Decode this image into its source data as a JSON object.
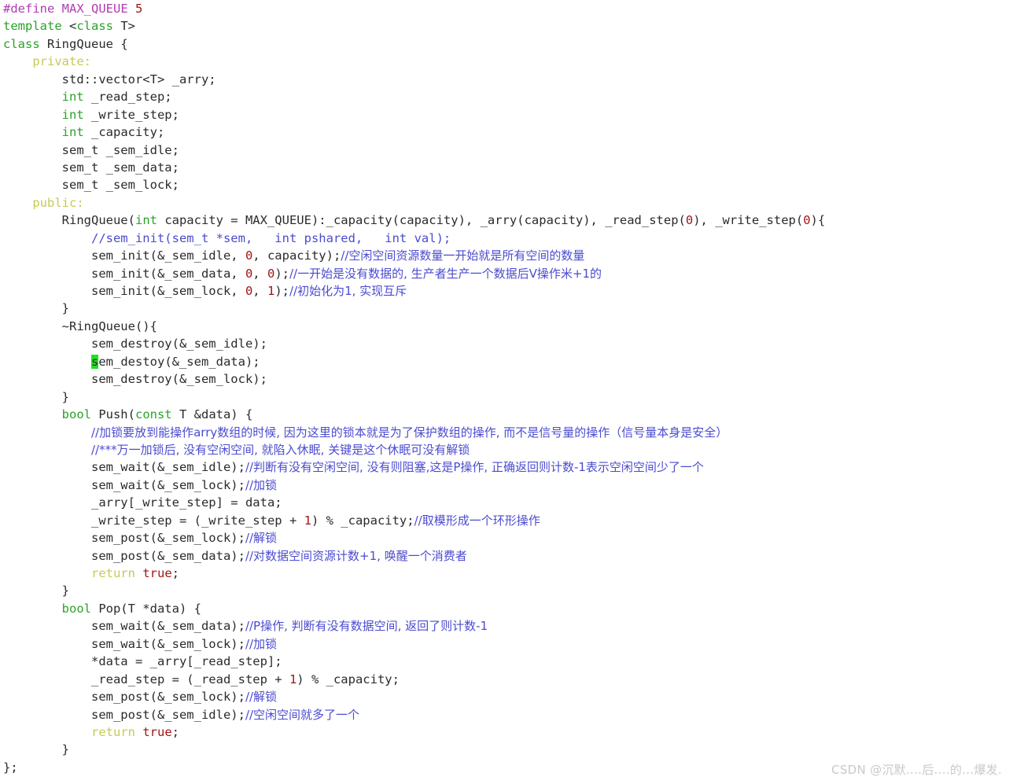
{
  "editor": {
    "language": "cpp",
    "theme_background": "#ffffff",
    "colors": {
      "preprocessor": "#b23bb2",
      "keyword_type": "#29a329",
      "access_specifier": "#c6ca55",
      "number": "#a31515",
      "boolean": "#a31515",
      "return_keyword": "#c6ca55",
      "comment": "#4b4bd0",
      "plain_text": "#2b2b2b",
      "cursor_highlight": "#22e022"
    },
    "cursor": {
      "line": 18,
      "highlighted_char": "s"
    }
  },
  "lines": [
    {
      "id": 1,
      "indent": 0,
      "tokens": [
        {
          "t": "#define",
          "c": "pre"
        },
        {
          "t": " ",
          "c": "plain"
        },
        {
          "t": "MAX_QUEUE",
          "c": "macro"
        },
        {
          "t": " ",
          "c": "plain"
        },
        {
          "t": "5",
          "c": "num"
        }
      ]
    },
    {
      "id": 2,
      "indent": 0,
      "tokens": [
        {
          "t": "template",
          "c": "kw"
        },
        {
          "t": " <",
          "c": "plain"
        },
        {
          "t": "class",
          "c": "kw"
        },
        {
          "t": " T>",
          "c": "plain"
        }
      ]
    },
    {
      "id": 3,
      "indent": 0,
      "tokens": [
        {
          "t": "class",
          "c": "kw"
        },
        {
          "t": " RingQueue {",
          "c": "plain"
        }
      ]
    },
    {
      "id": 4,
      "indent": 1,
      "tokens": [
        {
          "t": "private",
          "c": "access"
        },
        {
          "t": ":",
          "c": "access"
        }
      ]
    },
    {
      "id": 5,
      "indent": 2,
      "tokens": [
        {
          "t": "std::vector<T> _arry;",
          "c": "plain"
        }
      ]
    },
    {
      "id": 6,
      "indent": 2,
      "tokens": [
        {
          "t": "int",
          "c": "kw"
        },
        {
          "t": " _read_step;",
          "c": "plain"
        }
      ]
    },
    {
      "id": 7,
      "indent": 2,
      "tokens": [
        {
          "t": "int",
          "c": "kw"
        },
        {
          "t": " _write_step;",
          "c": "plain"
        }
      ]
    },
    {
      "id": 8,
      "indent": 2,
      "tokens": [
        {
          "t": "int",
          "c": "kw"
        },
        {
          "t": " _capacity;",
          "c": "plain"
        }
      ]
    },
    {
      "id": 9,
      "indent": 2,
      "tokens": [
        {
          "t": "sem_t _sem_idle;",
          "c": "plain"
        }
      ]
    },
    {
      "id": 10,
      "indent": 2,
      "tokens": [
        {
          "t": "sem_t _sem_data;",
          "c": "plain"
        }
      ]
    },
    {
      "id": 11,
      "indent": 2,
      "tokens": [
        {
          "t": "sem_t _sem_lock;",
          "c": "plain"
        }
      ]
    },
    {
      "id": 12,
      "indent": 1,
      "tokens": [
        {
          "t": "public",
          "c": "access"
        },
        {
          "t": ":",
          "c": "access"
        }
      ]
    },
    {
      "id": 13,
      "indent": 2,
      "tokens": [
        {
          "t": "RingQueue(",
          "c": "plain"
        },
        {
          "t": "int",
          "c": "kw"
        },
        {
          "t": " capacity = MAX_QUEUE):_capacity(capacity), _arry(capacity), _read_step(",
          "c": "plain"
        },
        {
          "t": "0",
          "c": "num"
        },
        {
          "t": "), _write_step(",
          "c": "plain"
        },
        {
          "t": "0",
          "c": "num"
        },
        {
          "t": "){",
          "c": "plain"
        }
      ]
    },
    {
      "id": 14,
      "indent": 3,
      "tokens": [
        {
          "t": "//sem_init(sem_t *sem,   int pshared,   int val);",
          "c": "cmt"
        }
      ]
    },
    {
      "id": 15,
      "indent": 3,
      "tokens": [
        {
          "t": "sem_init(&_sem_idle, ",
          "c": "plain"
        },
        {
          "t": "0",
          "c": "num"
        },
        {
          "t": ", capacity);",
          "c": "plain"
        },
        {
          "t": "//空闲空间资源数量一开始就是所有空间的数量",
          "c": "cmt-cn"
        }
      ]
    },
    {
      "id": 16,
      "indent": 3,
      "tokens": [
        {
          "t": "sem_init(&_sem_data, ",
          "c": "plain"
        },
        {
          "t": "0",
          "c": "num"
        },
        {
          "t": ", ",
          "c": "plain"
        },
        {
          "t": "0",
          "c": "num"
        },
        {
          "t": ");",
          "c": "plain"
        },
        {
          "t": "//一开始是没有数据的, 生产者生产一个数据后V操作米+1的",
          "c": "cmt-cn"
        }
      ]
    },
    {
      "id": 17,
      "indent": 3,
      "tokens": [
        {
          "t": "sem_init(&_sem_lock, ",
          "c": "plain"
        },
        {
          "t": "0",
          "c": "num"
        },
        {
          "t": ", ",
          "c": "plain"
        },
        {
          "t": "1",
          "c": "num"
        },
        {
          "t": ");",
          "c": "plain"
        },
        {
          "t": "//初始化为1, 实现互斥",
          "c": "cmt-cn"
        }
      ]
    },
    {
      "id": 18,
      "indent": 2,
      "tokens": [
        {
          "t": "}",
          "c": "plain"
        }
      ]
    },
    {
      "id": 19,
      "indent": 2,
      "tokens": [
        {
          "t": "~RingQueue(){",
          "c": "plain"
        }
      ]
    },
    {
      "id": 20,
      "indent": 3,
      "tokens": [
        {
          "t": "sem_destroy(&_sem_idle);",
          "c": "plain"
        }
      ]
    },
    {
      "id": 21,
      "indent": 3,
      "tokens": [
        {
          "t": "s",
          "c": "cursor"
        },
        {
          "t": "em_destoy(&_sem_data);",
          "c": "plain"
        }
      ]
    },
    {
      "id": 22,
      "indent": 3,
      "tokens": [
        {
          "t": "sem_destroy(&_sem_lock);",
          "c": "plain"
        }
      ]
    },
    {
      "id": 23,
      "indent": 2,
      "tokens": [
        {
          "t": "}",
          "c": "plain"
        }
      ]
    },
    {
      "id": 24,
      "indent": 2,
      "tokens": [
        {
          "t": "bool",
          "c": "kw"
        },
        {
          "t": " Push(",
          "c": "plain"
        },
        {
          "t": "const",
          "c": "kw"
        },
        {
          "t": " T &data) {",
          "c": "plain"
        }
      ]
    },
    {
      "id": 25,
      "indent": 3,
      "tokens": [
        {
          "t": "//加锁要放到能操作arry数组的时候, 因为这里的锁本就是为了保护数组的操作, 而不是信号量的操作（信号量本身是安全）",
          "c": "cmt-cn"
        }
      ]
    },
    {
      "id": 26,
      "indent": 3,
      "tokens": [
        {
          "t": "//***万一加锁后, 没有空闲空间, 就陷入休眠, 关键是这个休眠可没有解锁",
          "c": "cmt-cn"
        }
      ]
    },
    {
      "id": 27,
      "indent": 3,
      "tokens": [
        {
          "t": "sem_wait(&_sem_idle);",
          "c": "plain"
        },
        {
          "t": "//判断有没有空闲空间, 没有则阻塞,这是P操作, 正确返回则计数-1表示空闲空间少了一个",
          "c": "cmt-cn"
        }
      ]
    },
    {
      "id": 28,
      "indent": 3,
      "tokens": [
        {
          "t": "sem_wait(&_sem_lock);",
          "c": "plain"
        },
        {
          "t": "//加锁",
          "c": "cmt-cn"
        }
      ]
    },
    {
      "id": 29,
      "indent": 3,
      "tokens": [
        {
          "t": "_arry[_write_step] = data;",
          "c": "plain"
        }
      ]
    },
    {
      "id": 30,
      "indent": 3,
      "tokens": [
        {
          "t": "_write_step = (_write_step + ",
          "c": "plain"
        },
        {
          "t": "1",
          "c": "num"
        },
        {
          "t": ") % _capacity;",
          "c": "plain"
        },
        {
          "t": "//取模形成一个环形操作",
          "c": "cmt-cn"
        }
      ]
    },
    {
      "id": 31,
      "indent": 3,
      "tokens": [
        {
          "t": "sem_post(&_sem_lock);",
          "c": "plain"
        },
        {
          "t": "//解锁",
          "c": "cmt-cn"
        }
      ]
    },
    {
      "id": 32,
      "indent": 3,
      "tokens": [
        {
          "t": "sem_post(&_sem_data);",
          "c": "plain"
        },
        {
          "t": "//对数据空间资源计数+1, 唤醒一个消费者",
          "c": "cmt-cn"
        }
      ]
    },
    {
      "id": 33,
      "indent": 3,
      "tokens": [
        {
          "t": "return",
          "c": "ret"
        },
        {
          "t": " ",
          "c": "plain"
        },
        {
          "t": "true",
          "c": "bool"
        },
        {
          "t": ";",
          "c": "plain"
        }
      ]
    },
    {
      "id": 34,
      "indent": 2,
      "tokens": [
        {
          "t": "}",
          "c": "plain"
        }
      ]
    },
    {
      "id": 35,
      "indent": 2,
      "tokens": [
        {
          "t": "bool",
          "c": "kw"
        },
        {
          "t": " Pop(T *data) {",
          "c": "plain"
        }
      ]
    },
    {
      "id": 36,
      "indent": 3,
      "tokens": [
        {
          "t": "sem_wait(&_sem_data);",
          "c": "plain"
        },
        {
          "t": "//P操作, 判断有没有数据空间, 返回了则计数-1",
          "c": "cmt-cn"
        }
      ]
    },
    {
      "id": 37,
      "indent": 3,
      "tokens": [
        {
          "t": "sem_wait(&_sem_lock);",
          "c": "plain"
        },
        {
          "t": "//加锁",
          "c": "cmt-cn"
        }
      ]
    },
    {
      "id": 38,
      "indent": 3,
      "tokens": [
        {
          "t": "*data = _arry[_read_step];",
          "c": "plain"
        }
      ]
    },
    {
      "id": 39,
      "indent": 3,
      "tokens": [
        {
          "t": "_read_step = (_read_step + ",
          "c": "plain"
        },
        {
          "t": "1",
          "c": "num"
        },
        {
          "t": ") % _capacity;",
          "c": "plain"
        }
      ]
    },
    {
      "id": 40,
      "indent": 3,
      "tokens": [
        {
          "t": "sem_post(&_sem_lock);",
          "c": "plain"
        },
        {
          "t": "//解锁",
          "c": "cmt-cn"
        }
      ]
    },
    {
      "id": 41,
      "indent": 3,
      "tokens": [
        {
          "t": "sem_post(&_sem_idle);",
          "c": "plain"
        },
        {
          "t": "//空闲空间就多了一个",
          "c": "cmt-cn"
        }
      ]
    },
    {
      "id": 42,
      "indent": 3,
      "tokens": [
        {
          "t": "return",
          "c": "ret"
        },
        {
          "t": " ",
          "c": "plain"
        },
        {
          "t": "true",
          "c": "bool"
        },
        {
          "t": ";",
          "c": "plain"
        }
      ]
    },
    {
      "id": 43,
      "indent": 2,
      "tokens": [
        {
          "t": "}",
          "c": "plain"
        }
      ]
    },
    {
      "id": 44,
      "indent": 0,
      "tokens": [
        {
          "t": "};",
          "c": "plain"
        }
      ]
    }
  ],
  "watermark": {
    "text": "CSDN @沉默....后....的...爆发."
  }
}
